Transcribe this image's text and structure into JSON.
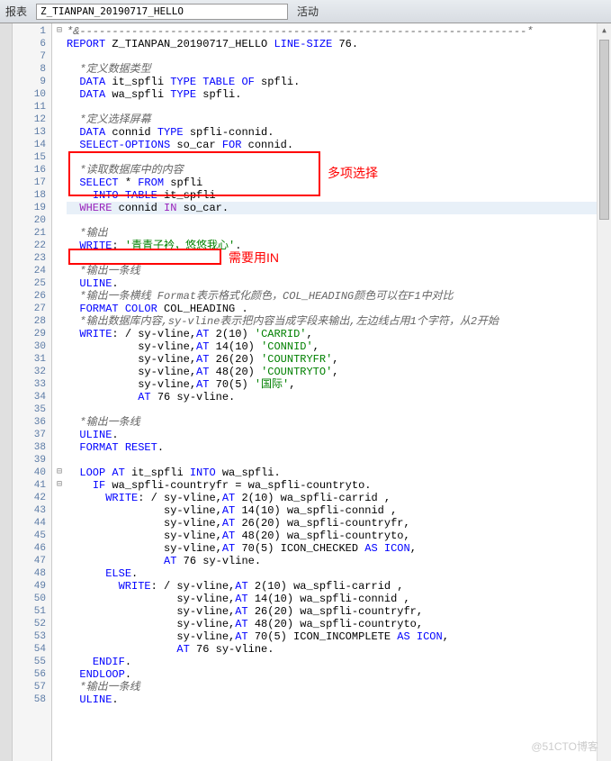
{
  "toolbar": {
    "label": "报表",
    "program_name": "Z_TIANPAN_20190717_HELLO",
    "status": "活动"
  },
  "annotations": {
    "box1_label": "多项选择",
    "box2_label": "需要用IN"
  },
  "watermark": "@51CTO博客",
  "code_lines": [
    {
      "n": 1,
      "fold": "⊟",
      "t": [
        {
          "c": "cmt",
          "s": "*&---------------------------------------------------------------------*"
        }
      ]
    },
    {
      "n": 6,
      "t": [
        {
          "c": "kw",
          "s": "REPORT"
        },
        {
          "c": "txt",
          "s": " Z_TIANPAN_20190717_HELLO "
        },
        {
          "c": "kw",
          "s": "LINE-SIZE"
        },
        {
          "c": "txt",
          "s": " "
        },
        {
          "c": "num",
          "s": "76"
        },
        {
          "c": "txt",
          "s": "."
        }
      ]
    },
    {
      "n": 7,
      "t": []
    },
    {
      "n": 8,
      "t": [
        {
          "c": "txt",
          "s": "  "
        },
        {
          "c": "cmt",
          "s": "*定义数据类型"
        }
      ]
    },
    {
      "n": 9,
      "t": [
        {
          "c": "txt",
          "s": "  "
        },
        {
          "c": "kw",
          "s": "DATA"
        },
        {
          "c": "txt",
          "s": " it_spfli "
        },
        {
          "c": "kw",
          "s": "TYPE TABLE OF"
        },
        {
          "c": "txt",
          "s": " spfli."
        }
      ]
    },
    {
      "n": 10,
      "t": [
        {
          "c": "txt",
          "s": "  "
        },
        {
          "c": "kw",
          "s": "DATA"
        },
        {
          "c": "txt",
          "s": " wa_spfli "
        },
        {
          "c": "kw",
          "s": "TYPE"
        },
        {
          "c": "txt",
          "s": " spfli."
        }
      ]
    },
    {
      "n": 11,
      "t": []
    },
    {
      "n": 12,
      "t": [
        {
          "c": "txt",
          "s": "  "
        },
        {
          "c": "cmt",
          "s": "*定义选择屏幕"
        }
      ]
    },
    {
      "n": 13,
      "t": [
        {
          "c": "txt",
          "s": "  "
        },
        {
          "c": "kw",
          "s": "DATA"
        },
        {
          "c": "txt",
          "s": " connid "
        },
        {
          "c": "kw",
          "s": "TYPE"
        },
        {
          "c": "txt",
          "s": " spfli-connid."
        }
      ]
    },
    {
      "n": 14,
      "t": [
        {
          "c": "txt",
          "s": "  "
        },
        {
          "c": "kw",
          "s": "SELECT-OPTIONS"
        },
        {
          "c": "txt",
          "s": " so_car "
        },
        {
          "c": "kw",
          "s": "FOR"
        },
        {
          "c": "txt",
          "s": " connid."
        }
      ]
    },
    {
      "n": 15,
      "t": []
    },
    {
      "n": 16,
      "t": [
        {
          "c": "txt",
          "s": "  "
        },
        {
          "c": "cmt",
          "s": "*读取数据库中的内容"
        }
      ]
    },
    {
      "n": 17,
      "t": [
        {
          "c": "txt",
          "s": "  "
        },
        {
          "c": "kw",
          "s": "SELECT"
        },
        {
          "c": "txt",
          "s": " * "
        },
        {
          "c": "kw",
          "s": "FROM"
        },
        {
          "c": "txt",
          "s": " spfli"
        }
      ]
    },
    {
      "n": 18,
      "t": [
        {
          "c": "txt",
          "s": "    "
        },
        {
          "c": "kw",
          "s": "INTO TABLE"
        },
        {
          "c": "txt",
          "s": " it_spfli"
        }
      ]
    },
    {
      "n": 19,
      "hl": true,
      "t": [
        {
          "c": "txt",
          "s": "  "
        },
        {
          "c": "addclause",
          "s": "WHERE"
        },
        {
          "c": "txt",
          "s": " connid "
        },
        {
          "c": "addclause",
          "s": "IN"
        },
        {
          "c": "txt",
          "s": " so_car."
        }
      ]
    },
    {
      "n": 20,
      "t": []
    },
    {
      "n": 21,
      "t": [
        {
          "c": "txt",
          "s": "  "
        },
        {
          "c": "cmt",
          "s": "*输出"
        }
      ]
    },
    {
      "n": 22,
      "t": [
        {
          "c": "txt",
          "s": "  "
        },
        {
          "c": "kw",
          "s": "WRITE"
        },
        {
          "c": "txt",
          "s": ": "
        },
        {
          "c": "str",
          "s": "'青青子衿，悠悠我心'"
        },
        {
          "c": "txt",
          "s": "."
        }
      ]
    },
    {
      "n": 23,
      "t": []
    },
    {
      "n": 24,
      "t": [
        {
          "c": "txt",
          "s": "  "
        },
        {
          "c": "cmt",
          "s": "*输出一条线"
        }
      ]
    },
    {
      "n": 25,
      "t": [
        {
          "c": "txt",
          "s": "  "
        },
        {
          "c": "kw",
          "s": "ULINE"
        },
        {
          "c": "txt",
          "s": "."
        }
      ]
    },
    {
      "n": 26,
      "t": [
        {
          "c": "txt",
          "s": "  "
        },
        {
          "c": "cmt",
          "s": "*输出一条横线 Format表示格式化颜色，COL_HEADING颜色可以在F1中对比"
        }
      ]
    },
    {
      "n": 27,
      "t": [
        {
          "c": "txt",
          "s": "  "
        },
        {
          "c": "kw",
          "s": "FORMAT COLOR"
        },
        {
          "c": "txt",
          "s": " COL_HEADING ."
        }
      ]
    },
    {
      "n": 28,
      "t": [
        {
          "c": "txt",
          "s": "  "
        },
        {
          "c": "cmt",
          "s": "*输出数据库内容,sy-vline表示把内容当成字段来输出,左边线占用1个字符，从2开始"
        }
      ]
    },
    {
      "n": 29,
      "t": [
        {
          "c": "txt",
          "s": "  "
        },
        {
          "c": "kw",
          "s": "WRITE"
        },
        {
          "c": "txt",
          "s": ": / sy-vline,"
        },
        {
          "c": "kw",
          "s": "AT"
        },
        {
          "c": "txt",
          "s": " "
        },
        {
          "c": "num",
          "s": "2"
        },
        {
          "c": "txt",
          "s": "("
        },
        {
          "c": "num",
          "s": "10"
        },
        {
          "c": "txt",
          "s": ") "
        },
        {
          "c": "str",
          "s": "'CARRID'"
        },
        {
          "c": "txt",
          "s": ","
        }
      ]
    },
    {
      "n": 30,
      "t": [
        {
          "c": "txt",
          "s": "           sy-vline,"
        },
        {
          "c": "kw",
          "s": "AT"
        },
        {
          "c": "txt",
          "s": " "
        },
        {
          "c": "num",
          "s": "14"
        },
        {
          "c": "txt",
          "s": "("
        },
        {
          "c": "num",
          "s": "10"
        },
        {
          "c": "txt",
          "s": ") "
        },
        {
          "c": "str",
          "s": "'CONNID'"
        },
        {
          "c": "txt",
          "s": ","
        }
      ]
    },
    {
      "n": 31,
      "t": [
        {
          "c": "txt",
          "s": "           sy-vline,"
        },
        {
          "c": "kw",
          "s": "AT"
        },
        {
          "c": "txt",
          "s": " "
        },
        {
          "c": "num",
          "s": "26"
        },
        {
          "c": "txt",
          "s": "("
        },
        {
          "c": "num",
          "s": "20"
        },
        {
          "c": "txt",
          "s": ") "
        },
        {
          "c": "str",
          "s": "'COUNTRYFR'"
        },
        {
          "c": "txt",
          "s": ","
        }
      ]
    },
    {
      "n": 32,
      "t": [
        {
          "c": "txt",
          "s": "           sy-vline,"
        },
        {
          "c": "kw",
          "s": "AT"
        },
        {
          "c": "txt",
          "s": " "
        },
        {
          "c": "num",
          "s": "48"
        },
        {
          "c": "txt",
          "s": "("
        },
        {
          "c": "num",
          "s": "20"
        },
        {
          "c": "txt",
          "s": ") "
        },
        {
          "c": "str",
          "s": "'COUNTRYTO'"
        },
        {
          "c": "txt",
          "s": ","
        }
      ]
    },
    {
      "n": 33,
      "t": [
        {
          "c": "txt",
          "s": "           sy-vline,"
        },
        {
          "c": "kw",
          "s": "AT"
        },
        {
          "c": "txt",
          "s": " "
        },
        {
          "c": "num",
          "s": "70"
        },
        {
          "c": "txt",
          "s": "("
        },
        {
          "c": "num",
          "s": "5"
        },
        {
          "c": "txt",
          "s": ") "
        },
        {
          "c": "str",
          "s": "'国际'"
        },
        {
          "c": "txt",
          "s": ","
        }
      ]
    },
    {
      "n": 34,
      "t": [
        {
          "c": "txt",
          "s": "           "
        },
        {
          "c": "kw",
          "s": "AT"
        },
        {
          "c": "txt",
          "s": " "
        },
        {
          "c": "num",
          "s": "76"
        },
        {
          "c": "txt",
          "s": " sy-vline."
        }
      ]
    },
    {
      "n": 35,
      "t": []
    },
    {
      "n": 36,
      "t": [
        {
          "c": "txt",
          "s": "  "
        },
        {
          "c": "cmt",
          "s": "*输出一条线"
        }
      ]
    },
    {
      "n": 37,
      "t": [
        {
          "c": "txt",
          "s": "  "
        },
        {
          "c": "kw",
          "s": "ULINE"
        },
        {
          "c": "txt",
          "s": "."
        }
      ]
    },
    {
      "n": 38,
      "t": [
        {
          "c": "txt",
          "s": "  "
        },
        {
          "c": "kw",
          "s": "FORMAT RESET"
        },
        {
          "c": "txt",
          "s": "."
        }
      ]
    },
    {
      "n": 39,
      "t": []
    },
    {
      "n": 40,
      "fold": "⊟",
      "t": [
        {
          "c": "txt",
          "s": "  "
        },
        {
          "c": "kw",
          "s": "LOOP AT"
        },
        {
          "c": "txt",
          "s": " it_spfli "
        },
        {
          "c": "kw",
          "s": "INTO"
        },
        {
          "c": "txt",
          "s": " wa_spfli."
        }
      ]
    },
    {
      "n": 41,
      "fold": "⊟",
      "t": [
        {
          "c": "txt",
          "s": "    "
        },
        {
          "c": "kw",
          "s": "IF"
        },
        {
          "c": "txt",
          "s": " wa_spfli-countryfr = wa_spfli-countryto."
        }
      ]
    },
    {
      "n": 42,
      "t": [
        {
          "c": "txt",
          "s": "      "
        },
        {
          "c": "kw",
          "s": "WRITE"
        },
        {
          "c": "txt",
          "s": ": / sy-vline,"
        },
        {
          "c": "kw",
          "s": "AT"
        },
        {
          "c": "txt",
          "s": " "
        },
        {
          "c": "num",
          "s": "2"
        },
        {
          "c": "txt",
          "s": "("
        },
        {
          "c": "num",
          "s": "10"
        },
        {
          "c": "txt",
          "s": ") wa_spfli-carrid ,"
        }
      ]
    },
    {
      "n": 43,
      "t": [
        {
          "c": "txt",
          "s": "               sy-vline,"
        },
        {
          "c": "kw",
          "s": "AT"
        },
        {
          "c": "txt",
          "s": " "
        },
        {
          "c": "num",
          "s": "14"
        },
        {
          "c": "txt",
          "s": "("
        },
        {
          "c": "num",
          "s": "10"
        },
        {
          "c": "txt",
          "s": ") wa_spfli-connid ,"
        }
      ]
    },
    {
      "n": 44,
      "t": [
        {
          "c": "txt",
          "s": "               sy-vline,"
        },
        {
          "c": "kw",
          "s": "AT"
        },
        {
          "c": "txt",
          "s": " "
        },
        {
          "c": "num",
          "s": "26"
        },
        {
          "c": "txt",
          "s": "("
        },
        {
          "c": "num",
          "s": "20"
        },
        {
          "c": "txt",
          "s": ") wa_spfli-countryfr,"
        }
      ]
    },
    {
      "n": 45,
      "t": [
        {
          "c": "txt",
          "s": "               sy-vline,"
        },
        {
          "c": "kw",
          "s": "AT"
        },
        {
          "c": "txt",
          "s": " "
        },
        {
          "c": "num",
          "s": "48"
        },
        {
          "c": "txt",
          "s": "("
        },
        {
          "c": "num",
          "s": "20"
        },
        {
          "c": "txt",
          "s": ") wa_spfli-countryto,"
        }
      ]
    },
    {
      "n": 46,
      "t": [
        {
          "c": "txt",
          "s": "               sy-vline,"
        },
        {
          "c": "kw",
          "s": "AT"
        },
        {
          "c": "txt",
          "s": " "
        },
        {
          "c": "num",
          "s": "70"
        },
        {
          "c": "txt",
          "s": "("
        },
        {
          "c": "num",
          "s": "5"
        },
        {
          "c": "txt",
          "s": ") ICON_CHECKED "
        },
        {
          "c": "kw",
          "s": "AS ICON"
        },
        {
          "c": "txt",
          "s": ","
        }
      ]
    },
    {
      "n": 47,
      "t": [
        {
          "c": "txt",
          "s": "               "
        },
        {
          "c": "kw",
          "s": "AT"
        },
        {
          "c": "txt",
          "s": " "
        },
        {
          "c": "num",
          "s": "76"
        },
        {
          "c": "txt",
          "s": " sy-vline."
        }
      ]
    },
    {
      "n": 48,
      "t": [
        {
          "c": "txt",
          "s": "      "
        },
        {
          "c": "kw",
          "s": "ELSE"
        },
        {
          "c": "txt",
          "s": "."
        }
      ]
    },
    {
      "n": 49,
      "t": [
        {
          "c": "txt",
          "s": "        "
        },
        {
          "c": "kw",
          "s": "WRITE"
        },
        {
          "c": "txt",
          "s": ": / sy-vline,"
        },
        {
          "c": "kw",
          "s": "AT"
        },
        {
          "c": "txt",
          "s": " "
        },
        {
          "c": "num",
          "s": "2"
        },
        {
          "c": "txt",
          "s": "("
        },
        {
          "c": "num",
          "s": "10"
        },
        {
          "c": "txt",
          "s": ") wa_spfli-carrid ,"
        }
      ]
    },
    {
      "n": 50,
      "t": [
        {
          "c": "txt",
          "s": "                 sy-vline,"
        },
        {
          "c": "kw",
          "s": "AT"
        },
        {
          "c": "txt",
          "s": " "
        },
        {
          "c": "num",
          "s": "14"
        },
        {
          "c": "txt",
          "s": "("
        },
        {
          "c": "num",
          "s": "10"
        },
        {
          "c": "txt",
          "s": ") wa_spfli-connid ,"
        }
      ]
    },
    {
      "n": 51,
      "t": [
        {
          "c": "txt",
          "s": "                 sy-vline,"
        },
        {
          "c": "kw",
          "s": "AT"
        },
        {
          "c": "txt",
          "s": " "
        },
        {
          "c": "num",
          "s": "26"
        },
        {
          "c": "txt",
          "s": "("
        },
        {
          "c": "num",
          "s": "20"
        },
        {
          "c": "txt",
          "s": ") wa_spfli-countryfr,"
        }
      ]
    },
    {
      "n": 52,
      "t": [
        {
          "c": "txt",
          "s": "                 sy-vline,"
        },
        {
          "c": "kw",
          "s": "AT"
        },
        {
          "c": "txt",
          "s": " "
        },
        {
          "c": "num",
          "s": "48"
        },
        {
          "c": "txt",
          "s": "("
        },
        {
          "c": "num",
          "s": "20"
        },
        {
          "c": "txt",
          "s": ") wa_spfli-countryto,"
        }
      ]
    },
    {
      "n": 53,
      "t": [
        {
          "c": "txt",
          "s": "                 sy-vline,"
        },
        {
          "c": "kw",
          "s": "AT"
        },
        {
          "c": "txt",
          "s": " "
        },
        {
          "c": "num",
          "s": "70"
        },
        {
          "c": "txt",
          "s": "("
        },
        {
          "c": "num",
          "s": "5"
        },
        {
          "c": "txt",
          "s": ") ICON_INCOMPLETE "
        },
        {
          "c": "kw",
          "s": "AS ICON"
        },
        {
          "c": "txt",
          "s": ","
        }
      ]
    },
    {
      "n": 54,
      "t": [
        {
          "c": "txt",
          "s": "                 "
        },
        {
          "c": "kw",
          "s": "AT"
        },
        {
          "c": "txt",
          "s": " "
        },
        {
          "c": "num",
          "s": "76"
        },
        {
          "c": "txt",
          "s": " sy-vline."
        }
      ]
    },
    {
      "n": 55,
      "t": [
        {
          "c": "txt",
          "s": "    "
        },
        {
          "c": "kw",
          "s": "ENDIF"
        },
        {
          "c": "txt",
          "s": "."
        }
      ]
    },
    {
      "n": 56,
      "t": [
        {
          "c": "txt",
          "s": "  "
        },
        {
          "c": "kw",
          "s": "ENDLOOP"
        },
        {
          "c": "txt",
          "s": "."
        }
      ]
    },
    {
      "n": 57,
      "t": [
        {
          "c": "txt",
          "s": "  "
        },
        {
          "c": "cmt",
          "s": "*输出一条线"
        }
      ]
    },
    {
      "n": 58,
      "t": [
        {
          "c": "txt",
          "s": "  "
        },
        {
          "c": "kw",
          "s": "ULINE"
        },
        {
          "c": "txt",
          "s": "."
        }
      ]
    }
  ]
}
